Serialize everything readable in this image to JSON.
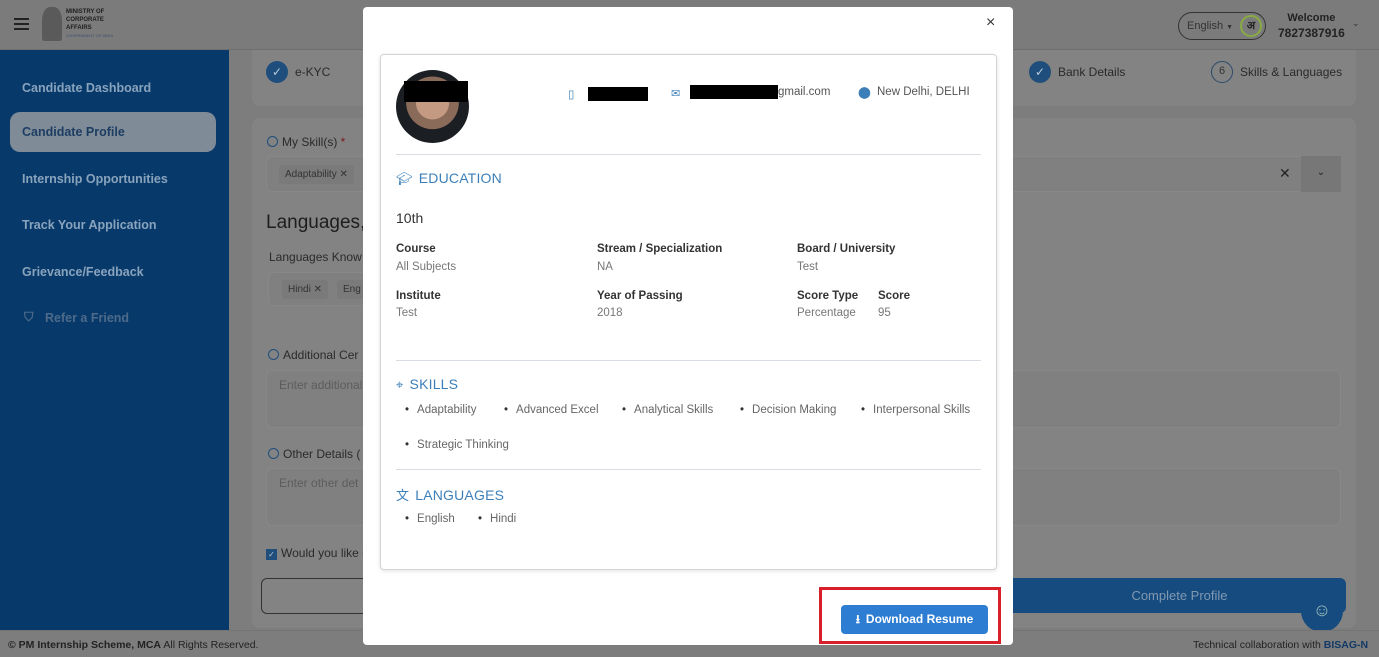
{
  "header": {
    "logo_lines": [
      "MINISTRY OF",
      "CORPORATE",
      "AFFAIRS",
      "GOVERNMENT OF INDIA"
    ],
    "language": "English",
    "language_icon": "अ",
    "welcome": "Welcome",
    "user_id": "7827387916"
  },
  "sidebar": {
    "items": [
      {
        "label": "Candidate Dashboard"
      },
      {
        "label": "Candidate Profile"
      },
      {
        "label": "Internship Opportunities"
      },
      {
        "label": "Track Your Application"
      },
      {
        "label": "Grievance/Feedback"
      },
      {
        "label": "Refer a Friend"
      }
    ]
  },
  "stepper": {
    "steps": [
      {
        "label": "e-KYC",
        "status": "done"
      },
      {
        "label": "Bank Details",
        "status": "done"
      },
      {
        "label": "Skills & Languages",
        "number": "6",
        "status": "current"
      }
    ]
  },
  "form": {
    "skills_label": "My Skill(s)",
    "required_mark": "*",
    "skill_chip": "Adaptability",
    "languages_heading": "Languages,",
    "languages_known_label": "Languages Know",
    "language_chips": [
      "Hindi",
      "Eng"
    ],
    "additional_label": "Additional Cer",
    "additional_placeholder": "Enter additional",
    "other_label": "Other Details (",
    "other_placeholder": "Enter other det",
    "consent_label": "Would you like u",
    "complete_button": "Complete Profile"
  },
  "footer": {
    "copyright": "© PM Internship Scheme, MCA",
    "rights": "All Rights Reserved.",
    "collab": "Technical collaboration with",
    "collab_brand": "BISAG-N"
  },
  "modal": {
    "close": "×",
    "contact": {
      "email_suffix": "gmail.com",
      "location": "New Delhi, DELHI"
    },
    "education": {
      "title": "EDUCATION",
      "level": "10th",
      "fields": [
        {
          "label": "Course",
          "value": "All Subjects"
        },
        {
          "label": "Stream / Specialization",
          "value": "NA"
        },
        {
          "label": "Board / University",
          "value": "Test"
        },
        {
          "label": "Institute",
          "value": "Test"
        },
        {
          "label": "Year of Passing",
          "value": "2018"
        },
        {
          "label": "Score Type",
          "value": "Percentage"
        },
        {
          "label": "Score",
          "value": "95"
        }
      ]
    },
    "skills": {
      "title": "SKILLS",
      "items": [
        "Adaptability",
        "Advanced Excel",
        "Analytical Skills",
        "Decision Making",
        "Interpersonal Skills",
        "Strategic Thinking"
      ]
    },
    "languages": {
      "title": "LANGUAGES",
      "items": [
        "English",
        "Hindi"
      ]
    },
    "download_button": "Download Resume",
    "highlight_color": "#d8202a",
    "accent_color": "#2d7dd2"
  }
}
